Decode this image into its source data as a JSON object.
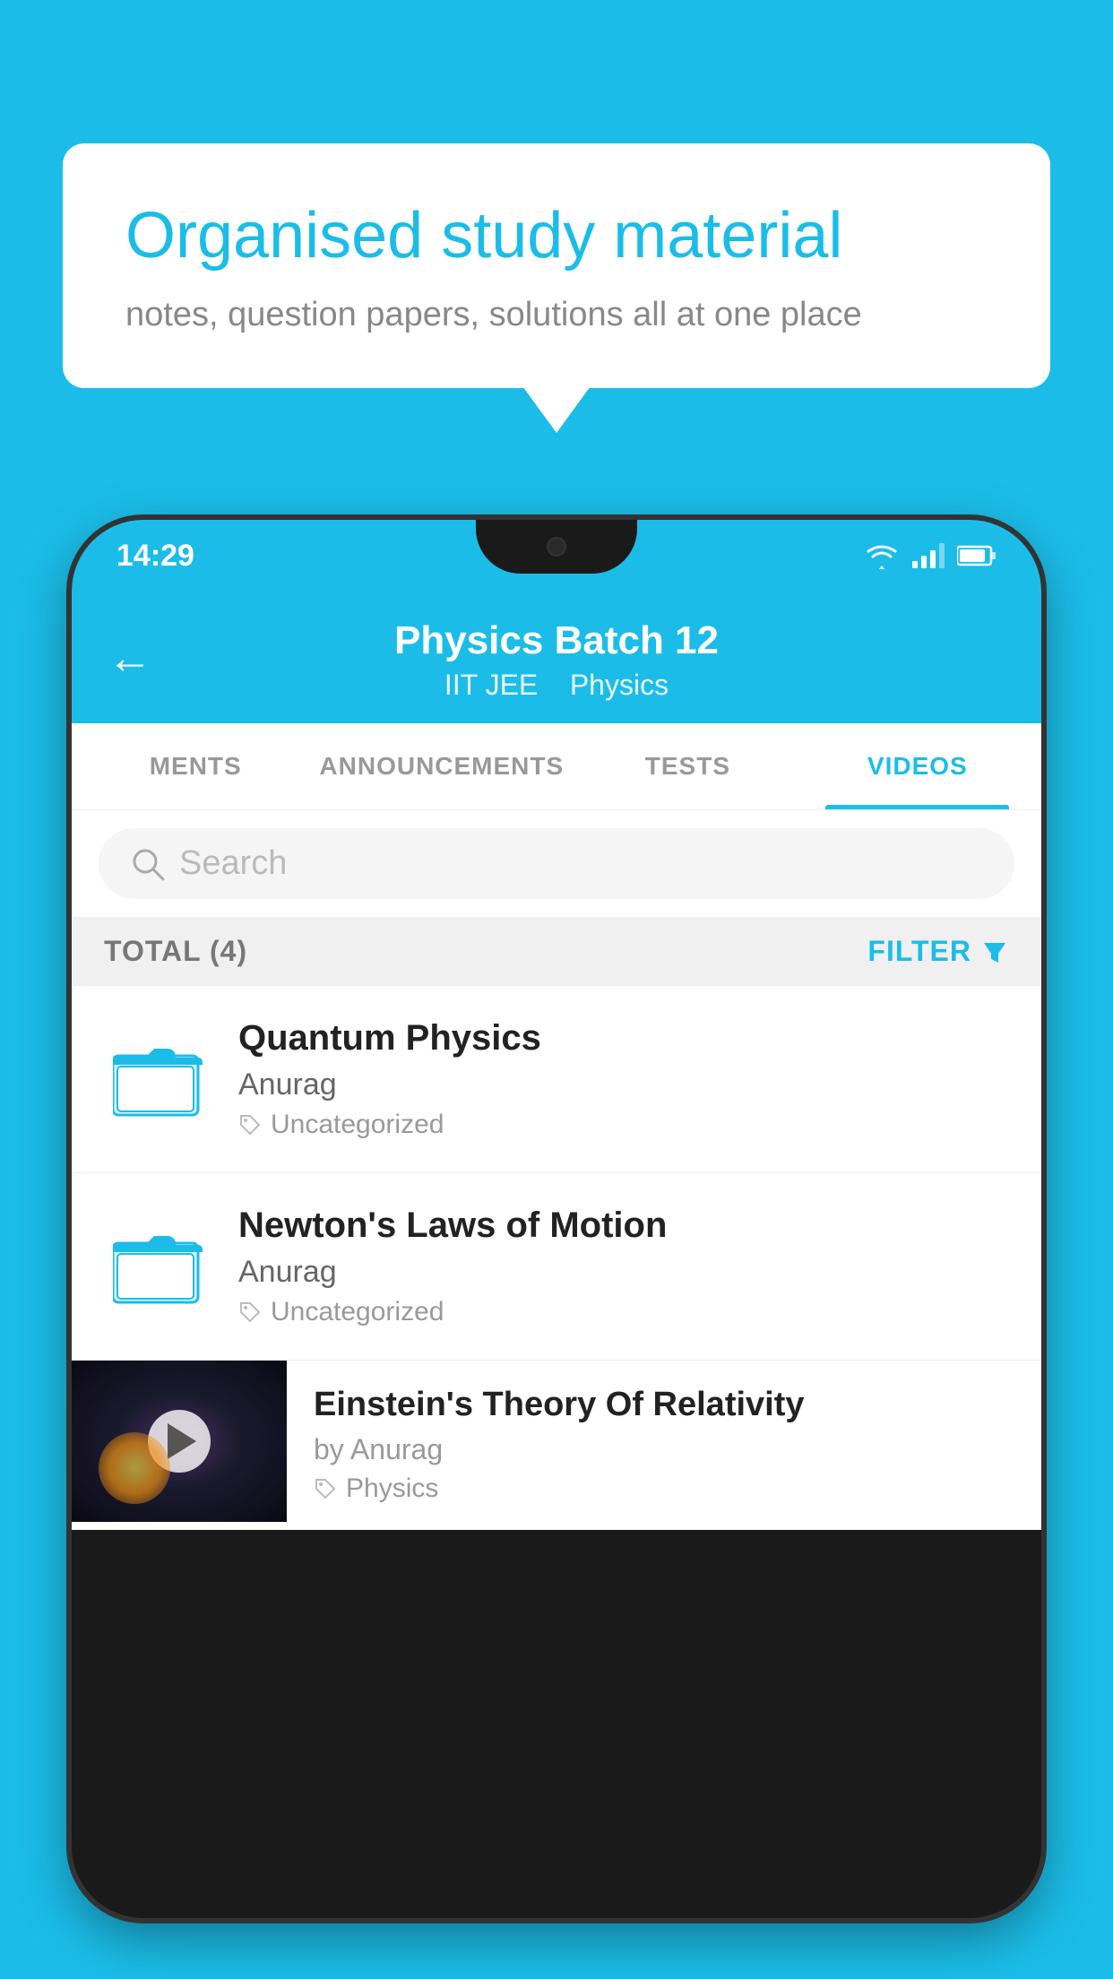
{
  "background_color": "#1BBDE8",
  "speech_bubble": {
    "title": "Organised study material",
    "subtitle": "notes, question papers, solutions all at one place"
  },
  "phone": {
    "status_bar": {
      "time": "14:29"
    },
    "header": {
      "back_label": "←",
      "title": "Physics Batch 12",
      "subtitle_part1": "IIT JEE",
      "subtitle_part2": "Physics"
    },
    "tabs": [
      {
        "label": "MENTS",
        "active": false
      },
      {
        "label": "ANNOUNCEMENTS",
        "active": false
      },
      {
        "label": "TESTS",
        "active": false
      },
      {
        "label": "VIDEOS",
        "active": true
      }
    ],
    "search": {
      "placeholder": "Search"
    },
    "filter_bar": {
      "total_label": "TOTAL (4)",
      "filter_label": "FILTER"
    },
    "videos": [
      {
        "id": 1,
        "title": "Quantum Physics",
        "author": "Anurag",
        "tag": "Uncategorized",
        "has_thumbnail": false
      },
      {
        "id": 2,
        "title": "Newton's Laws of Motion",
        "author": "Anurag",
        "tag": "Uncategorized",
        "has_thumbnail": false
      },
      {
        "id": 3,
        "title": "Einstein's Theory Of Relativity",
        "author": "by Anurag",
        "tag": "Physics",
        "has_thumbnail": true
      }
    ]
  }
}
